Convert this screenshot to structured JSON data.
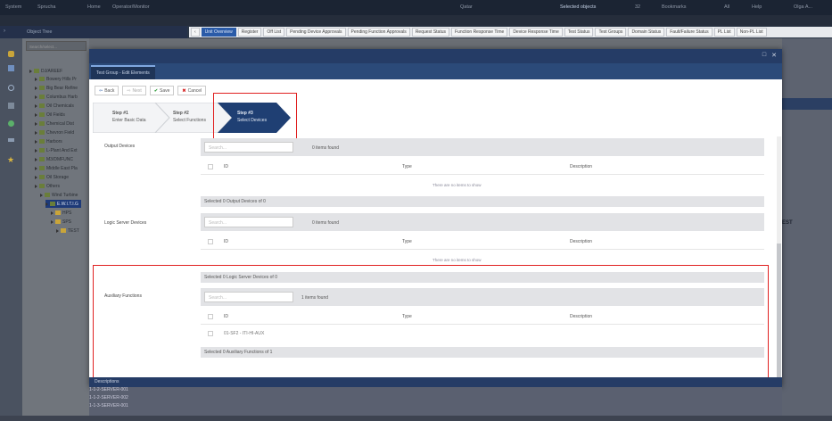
{
  "topbar": {
    "items": [
      "System",
      "Sprucha",
      "Home",
      "Operator/Monitor"
    ],
    "center": "Qatar",
    "selected_objects": "Selected objects",
    "count": "32",
    "bookmarks": "Bookmarks",
    "status": "All",
    "help": "Help",
    "user": "Olga A..."
  },
  "object_tree": {
    "title": "Object Tree",
    "search_placeholder": "Search/select..."
  },
  "tabs": [
    "Unit Overview",
    "Register",
    "Off List",
    "Pending Device Approvals",
    "Pending Function Approvals",
    "Request Status",
    "Function Response Time",
    "Device Response Time",
    "Test Status",
    "Test Groups",
    "Domain Status",
    "Fault/Failure Status",
    "PL List",
    "Non-PL List"
  ],
  "tree": [
    "DJ/AREEF",
    "Bowery Hills Pr",
    "Big Bear Refine",
    "Columbus Harb",
    "Oil Chemicals",
    "Oil Fields",
    "Chemical Dist",
    "Chevron Field",
    "Harbors",
    "L-Plant And Ext",
    "M3/DMFUNC",
    "Middle East Pla",
    "Oil Storage",
    "Others",
    "Wind Turbine",
    "E.W.I.T.I.G",
    "HPS",
    "SPS",
    "TEST"
  ],
  "modal": {
    "title_tab": "Test Group - Edit Elements",
    "toolbar": {
      "back": "Back",
      "next": "Next",
      "save": "Save",
      "cancel": "Cancel"
    },
    "steps": [
      {
        "num": "Step #1",
        "name": "Enter Basic Data"
      },
      {
        "num": "Step #2",
        "name": "Select Functions"
      },
      {
        "num": "Step #3",
        "name": "Select Devices"
      }
    ],
    "output": {
      "label": "Output Devices",
      "search": "Search...",
      "found": "0 items found",
      "col_id": "ID",
      "col_type": "Type",
      "col_desc": "Description",
      "empty": "There are no items to show",
      "selected": "Selected 0 Output Devices of 0"
    },
    "logic": {
      "label": "Logic Server Devices",
      "search": "Search...",
      "found": "0 items found",
      "col_id": "ID",
      "col_type": "Type",
      "col_desc": "Description",
      "empty": "There are no items to show",
      "selected": "Selected 0 Logic Server Devices of 0"
    },
    "aux": {
      "label": "Auxiliary Functions",
      "search": "Search...",
      "found": "1 items found",
      "col_id": "ID",
      "col_type": "Type",
      "col_desc": "Description",
      "row_id": "01-SF2 - ITI-HI-AUX",
      "selected": "Selected 0 Auxiliary Functions of 1"
    }
  },
  "bottom": {
    "label": "Descriptions",
    "rows": [
      "1-1-2-SERVER-001",
      "1-1-2-SERVER-002",
      "1-1-3-SERVER-001"
    ]
  },
  "right": {
    "label": "EST"
  }
}
